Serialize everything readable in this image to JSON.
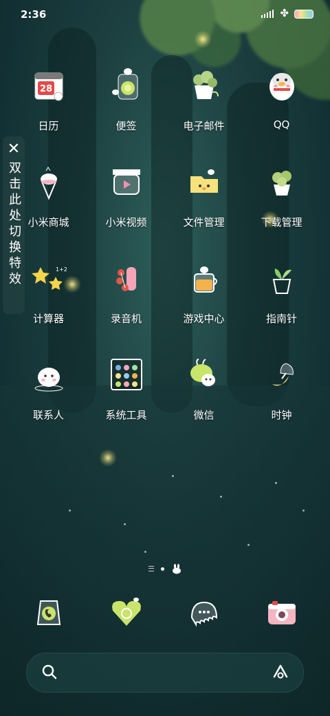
{
  "status": {
    "time": "2:36"
  },
  "side_panel": {
    "close_glyph": "✕",
    "text": "双击此处切换特效"
  },
  "apps": [
    {
      "label": "日历",
      "icon": "calendar-icon",
      "day": "28"
    },
    {
      "label": "便签",
      "icon": "notes-icon"
    },
    {
      "label": "电子邮件",
      "icon": "email-icon"
    },
    {
      "label": "QQ",
      "icon": "qq-penguin-icon"
    },
    {
      "label": "小米商城",
      "icon": "mi-store-icon"
    },
    {
      "label": "小米视频",
      "icon": "mi-video-icon"
    },
    {
      "label": "文件管理",
      "icon": "file-manager-icon"
    },
    {
      "label": "下载管理",
      "icon": "download-manager-icon"
    },
    {
      "label": "计算器",
      "icon": "calculator-icon"
    },
    {
      "label": "录音机",
      "icon": "recorder-icon"
    },
    {
      "label": "游戏中心",
      "icon": "game-center-icon"
    },
    {
      "label": "指南针",
      "icon": "compass-icon"
    },
    {
      "label": "联系人",
      "icon": "contacts-icon"
    },
    {
      "label": "系统工具",
      "icon": "system-tools-icon"
    },
    {
      "label": "微信",
      "icon": "wechat-icon"
    },
    {
      "label": "时钟",
      "icon": "clock-icon"
    }
  ],
  "dock": [
    {
      "name": "phone",
      "icon": "phone-icon"
    },
    {
      "name": "browser",
      "icon": "browser-icon"
    },
    {
      "name": "messages",
      "icon": "messages-icon"
    },
    {
      "name": "camera",
      "icon": "camera-icon"
    }
  ],
  "colors": {
    "background": "#1c3f40",
    "accent_yellow": "#f6e27a",
    "leaf_green": "#5c8a4a"
  }
}
